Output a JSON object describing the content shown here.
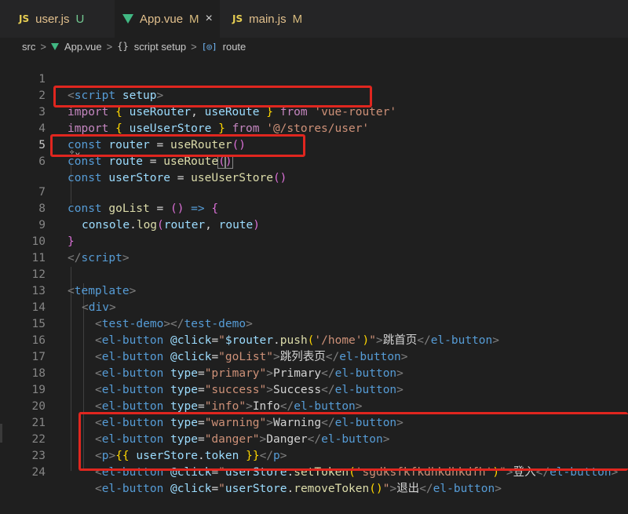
{
  "tabs": [
    {
      "icon": "JS",
      "name": "user.js",
      "badge": "U",
      "active": false
    },
    {
      "icon": "vue",
      "name": "App.vue",
      "badge": "M",
      "active": true,
      "close": "×"
    },
    {
      "icon": "JS",
      "name": "main.js",
      "badge": "M",
      "active": false
    }
  ],
  "breadcrumb": {
    "root": "src",
    "file": "App.vue",
    "section": "script setup",
    "symbol": "route",
    "separator": ">"
  },
  "lines": [
    {
      "n": "1"
    },
    {
      "n": "2"
    },
    {
      "n": "3"
    },
    {
      "n": "4"
    },
    {
      "n": "5"
    },
    {
      "n": "6"
    },
    {
      "n": "7"
    },
    {
      "n": "8"
    },
    {
      "n": "9"
    },
    {
      "n": "10"
    },
    {
      "n": "11"
    },
    {
      "n": "12"
    },
    {
      "n": "13"
    },
    {
      "n": "14"
    },
    {
      "n": "15"
    },
    {
      "n": "16"
    },
    {
      "n": "17"
    },
    {
      "n": "18"
    },
    {
      "n": "19"
    },
    {
      "n": "20"
    },
    {
      "n": "21"
    },
    {
      "n": "22"
    },
    {
      "n": "23"
    },
    {
      "n": "24"
    }
  ],
  "code": {
    "l1": {
      "open": "<",
      "tag": "script",
      "sp": " ",
      "attr": "setup",
      "close": ">"
    },
    "l2": {
      "kw": "import",
      "sp1": " ",
      "b1": "{",
      "sp2": " ",
      "v1": "useRouter",
      "c": ", ",
      "v2": "useRoute",
      "sp3": " ",
      "b2": "}",
      "sp4": " ",
      "from": "from",
      "sp5": " ",
      "str": "'vue-router'"
    },
    "l3": {
      "kw": "import",
      "sp1": " ",
      "b1": "{",
      "sp2": " ",
      "v1": "useUserStore",
      "sp3": " ",
      "b2": "}",
      "sp4": " ",
      "from": "from",
      "sp5": " ",
      "str": "'@/stores/user'"
    },
    "l4": {
      "decl": "const",
      "sp1": " ",
      "v": "router",
      "eq": " = ",
      "fn": "useRouter",
      "p": "()"
    },
    "l5": {
      "decl": "const",
      "sp1": " ",
      "v": "route",
      "eq": " = ",
      "fn": "useRoute",
      "p1": "(",
      "p2": ")"
    },
    "l6": {
      "decl": "const",
      "sp1": " ",
      "v": "userStore",
      "eq": " = ",
      "fn": "useUserStore",
      "p": "()"
    },
    "l7": {
      "decl": "const",
      "sp1": " ",
      "fn": "goList",
      "eq": " = ",
      "p": "()",
      "arrow": " => ",
      "b": "{"
    },
    "l8": {
      "obj": "console",
      "dot": ".",
      "fn": "log",
      "p1": "(",
      "a1": "router",
      "c": ", ",
      "a2": "route",
      "p2": ")"
    },
    "l9": {
      "b": "}"
    },
    "l10": {
      "open": "</",
      "tag": "script",
      "close": ">"
    },
    "l12": {
      "open": "<",
      "tag": "template",
      "close": ">"
    },
    "l13": {
      "open": "<",
      "tag": "div",
      "close": ">"
    },
    "l14": {
      "open": "<",
      "tag": "test-demo",
      "mid": "></",
      "tag2": "test-demo",
      "close": ">"
    },
    "l15": {
      "open": "<",
      "tag": "el-button",
      "sp": " ",
      "attr": "@click",
      "eq": "=",
      "q1": "\"",
      "v": "$router",
      "dot": ".",
      "fn": "push",
      "p1": "(",
      "str": "'/home'",
      "p2": ")",
      "q2": "\"",
      "gt": ">",
      "text": "跳首页",
      "end": "</",
      "tag2": "el-button",
      "close": ">"
    },
    "l16": {
      "open": "<",
      "tag": "el-button",
      "sp": " ",
      "attr": "@click",
      "eq": "=",
      "q": "\"goList\"",
      "gt": ">",
      "text": "跳列表页",
      "end": "</",
      "tag2": "el-button",
      "close": ">"
    },
    "l17": {
      "open": "<",
      "tag": "el-button",
      "sp": " ",
      "attr": "type",
      "eq": "=",
      "val": "\"primary\"",
      "gt": ">",
      "text": "Primary",
      "end": "</",
      "tag2": "el-button",
      "close": ">"
    },
    "l18": {
      "open": "<",
      "tag": "el-button",
      "sp": " ",
      "attr": "type",
      "eq": "=",
      "val": "\"success\"",
      "gt": ">",
      "text": "Success",
      "end": "</",
      "tag2": "el-button",
      "close": ">"
    },
    "l19": {
      "open": "<",
      "tag": "el-button",
      "sp": " ",
      "attr": "type",
      "eq": "=",
      "val": "\"info\"",
      "gt": ">",
      "text": "Info",
      "end": "</",
      "tag2": "el-button",
      "close": ">"
    },
    "l20": {
      "open": "<",
      "tag": "el-button",
      "sp": " ",
      "attr": "type",
      "eq": "=",
      "val": "\"warning\"",
      "gt": ">",
      "text": "Warning",
      "end": "</",
      "tag2": "el-button",
      "close": ">"
    },
    "l21": {
      "open": "<",
      "tag": "el-button",
      "sp": " ",
      "attr": "type",
      "eq": "=",
      "val": "\"danger\"",
      "gt": ">",
      "text": "Danger",
      "end": "</",
      "tag2": "el-button",
      "close": ">"
    },
    "l22": {
      "open": "<",
      "tag": "p",
      "gt": ">",
      "m1": "{{",
      "sp": " ",
      "v": "userStore",
      "dot": ".",
      "prop": "token",
      "sp2": " ",
      "m2": "}}",
      "end": "</",
      "tag2": "p",
      "close": ">"
    },
    "l23": {
      "open": "<",
      "tag": "el-button",
      "sp": " ",
      "attr": "@click",
      "eq": "=",
      "q1": "\"",
      "v": "userStore",
      "dot": ".",
      "fn": "setToken",
      "p1": "(",
      "str": "'sgdksfkfkdhkdhkdfh'",
      "p2": ")",
      "q2": "\"",
      "gt": ">",
      "text": "登入",
      "end": "</",
      "tag2": "el-button",
      "close": ">"
    },
    "l24": {
      "open": "<",
      "tag": "el-button",
      "sp": " ",
      "attr": "@click",
      "eq": "=",
      "q1": "\"",
      "v": "userStore",
      "dot": ".",
      "fn": "removeToken",
      "p": "()",
      "q2": "\"",
      "gt": ">",
      "text": "退出",
      "end": "</",
      "tag2": "el-button",
      "close": ">"
    }
  },
  "colors": {
    "highlight": "#e0261f",
    "background": "#1f1f1f"
  }
}
